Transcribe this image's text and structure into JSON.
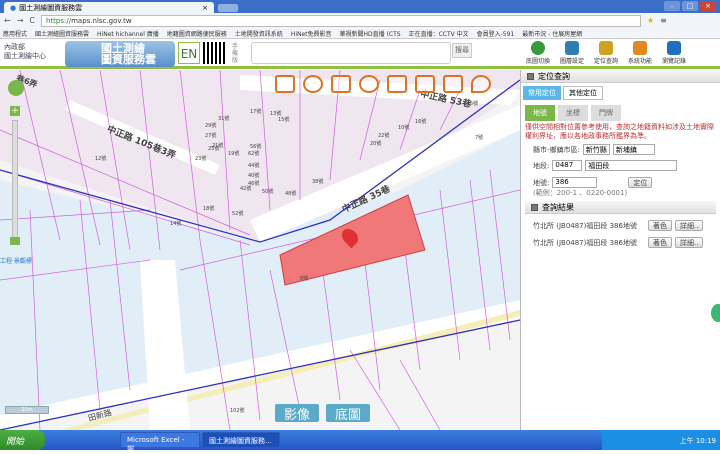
{
  "browser": {
    "tab_title": "國土測繪圖資服務雲",
    "tab_close": "×",
    "url_scheme": "https://",
    "url_host": "maps.nlsc.gov.tw",
    "bookmarks": [
      "應用程式",
      "國土測繪圖資服務雲",
      "HiNet hichannel 廣播",
      "地籍圖資網路便民服務",
      "土地開發資訊系統",
      "HiNet免費影音",
      "華視新聞HD直播 (CTS",
      "正在直播：CCTV 中文",
      "會員登入-591",
      "最新市況 - 住展房屋網"
    ]
  },
  "header": {
    "org_line1": "內政部",
    "org_line2": "國土測繪中心",
    "brand_line1": "國土測繪",
    "brand_line2": "圖資服務雲",
    "en": "EN",
    "mobile": "手機版",
    "search_btn": "搜尋",
    "buttons": [
      {
        "label": "底圖切換",
        "color": "#3a9a3a"
      },
      {
        "label": "圖層設定",
        "color": "#2f7fb0"
      },
      {
        "label": "定位查詢",
        "color": "#d0a020"
      },
      {
        "label": "系統功能",
        "color": "#e08a20"
      },
      {
        "label": "瀏覽記錄",
        "color": "#1f6fc0"
      }
    ]
  },
  "map": {
    "roads": [
      "中正路 53巷",
      "中正路 105巷3弄",
      "中正路 35巷",
      "田新路",
      "巷6弄"
    ],
    "lots": [
      "21號",
      "19號",
      "17號",
      "13號",
      "15號",
      "29號",
      "31號",
      "27號",
      "25號",
      "23號",
      "56號",
      "62號",
      "44號",
      "40號",
      "46號",
      "42號",
      "50號",
      "52號",
      "48號",
      "38號",
      "22號",
      "20號",
      "16號",
      "10號",
      "5號",
      "7號",
      "12號",
      "14號",
      "18號",
      "6號",
      "102號"
    ],
    "place_label": "工程·景觀標",
    "scale": "20m",
    "layer_image": "影像",
    "layer_base": "底圖"
  },
  "panel": {
    "title": "定位查詢",
    "tabs": [
      "常用定位",
      "其他定位"
    ],
    "subtabs": [
      "地號",
      "坐標",
      "門牌"
    ],
    "notice": "僅供空間相對位置參考使用，查詢之地籍資料如涉及土地實際權利界址，應以各地政事務所鑑界為準。",
    "county_label": "縣市-鄉鎮市區:",
    "county": "新竹縣",
    "town": "新埔鎮",
    "section_label": "地段:",
    "section_code": "0487",
    "section_name": "福田段",
    "lot_label": "地號:",
    "lot_value": "386",
    "locate_btn": "定位",
    "example": "(範例：200-1 、0220-0001)",
    "results_title": "查詢結果",
    "results": [
      {
        "text": "竹北所 (JB0487)福田段 386地號",
        "color_btn": "著色",
        "detail_btn": "詳細.."
      },
      {
        "text": "竹北所 (JB0487)福田段 386地號",
        "color_btn": "著色",
        "detail_btn": "詳細.."
      }
    ]
  },
  "taskbar": {
    "start": "開始",
    "tasks": [
      "Microsoft Excel - 謝...",
      "國土測繪圖資服務..."
    ],
    "clock": "上午 10:19"
  }
}
